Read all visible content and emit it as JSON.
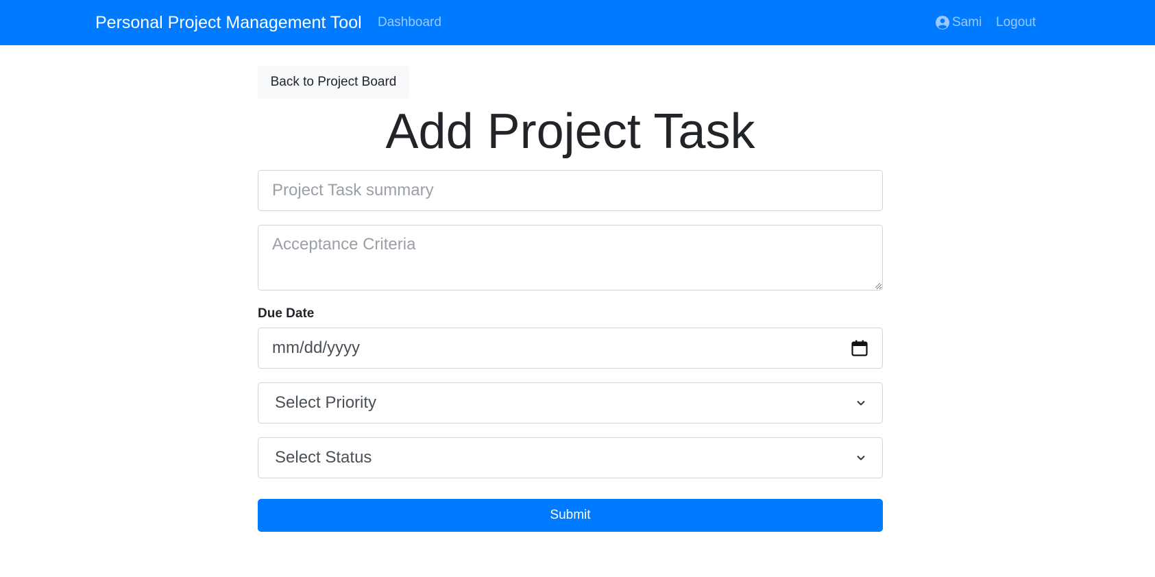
{
  "navbar": {
    "brand": "Personal Project Management Tool",
    "dashboard_label": "Dashboard",
    "user_name": "Sami",
    "logout_label": "Logout",
    "color": "#007bff"
  },
  "main": {
    "back_button_label": "Back to Project Board",
    "title": "Add Project Task",
    "summary_placeholder": "Project Task summary",
    "criteria_placeholder": "Acceptance Criteria",
    "due_date_label": "Due Date",
    "due_date_placeholder": "mm/dd/yyyy",
    "priority_selected": "Select Priority",
    "status_selected": "Select Status",
    "submit_label": "Submit"
  },
  "icons": {
    "user": "user-circle-icon",
    "calendar": "calendar-icon",
    "dropdown": "chevron-down-icon"
  }
}
